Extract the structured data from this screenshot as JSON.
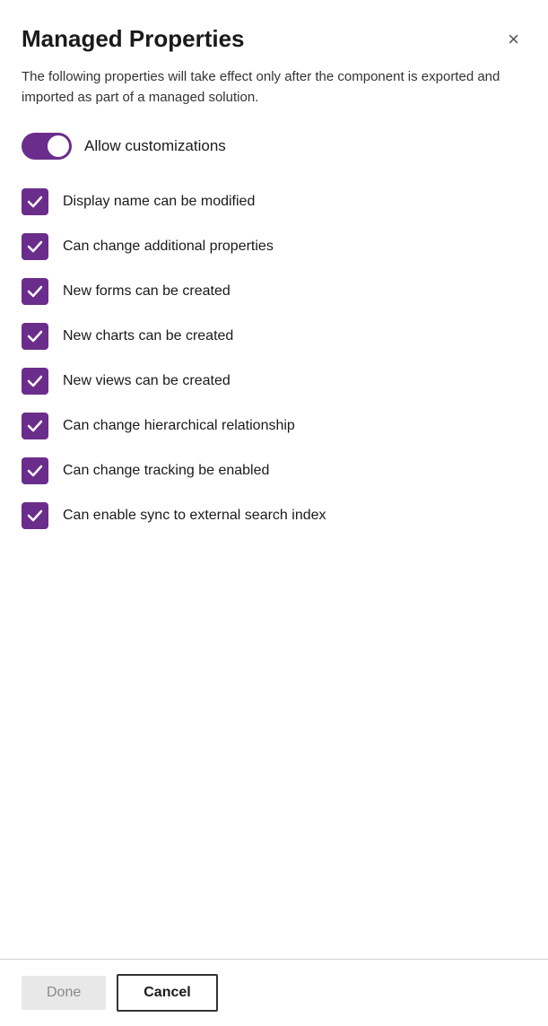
{
  "dialog": {
    "title": "Managed Properties",
    "description": "The following properties will take effect only after the component is exported and imported as part of a managed solution.",
    "close_label": "×",
    "toggle": {
      "label": "Allow customizations",
      "checked": true
    },
    "checkboxes": [
      {
        "id": "display-name",
        "label": "Display name can be modified",
        "checked": true
      },
      {
        "id": "additional-props",
        "label": "Can change additional properties",
        "checked": true
      },
      {
        "id": "new-forms",
        "label": "New forms can be created",
        "checked": true
      },
      {
        "id": "new-charts",
        "label": "New charts can be created",
        "checked": true
      },
      {
        "id": "new-views",
        "label": "New views can be created",
        "checked": true
      },
      {
        "id": "hierarchical",
        "label": "Can change hierarchical relationship",
        "checked": true
      },
      {
        "id": "tracking",
        "label": "Can change tracking be enabled",
        "checked": true
      },
      {
        "id": "sync-search",
        "label": "Can enable sync to external search index",
        "checked": true
      }
    ],
    "footer": {
      "done_label": "Done",
      "cancel_label": "Cancel"
    }
  }
}
